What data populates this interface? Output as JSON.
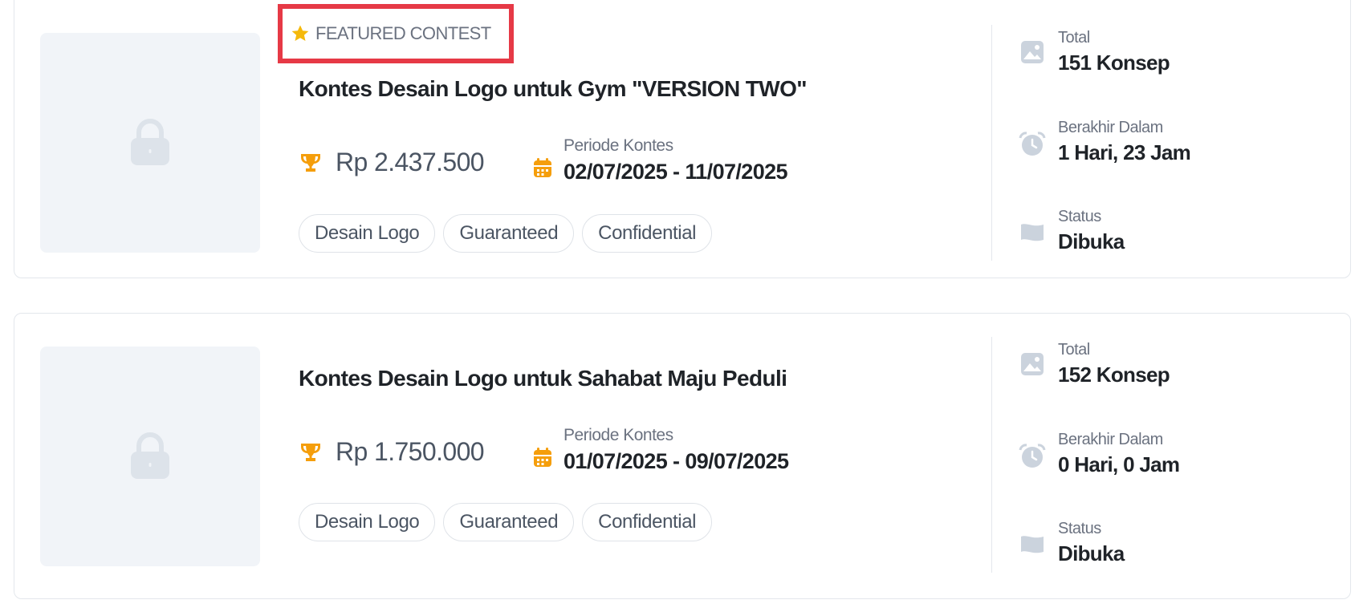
{
  "contests": [
    {
      "featured_label": "FEATURED CONTEST",
      "title": "Kontes Desain Logo untuk Gym \"VERSION TWO\"",
      "prize": "Rp 2.437.500",
      "period_label": "Periode Kontes",
      "period_value": "02/07/2025 - 11/07/2025",
      "tags": [
        "Desain Logo",
        "Guaranteed",
        "Confidential"
      ],
      "total_label": "Total",
      "total_value": "151 Konsep",
      "ends_label": "Berakhir Dalam",
      "ends_value": "1 Hari, 23 Jam",
      "status_label": "Status",
      "status_value": "Dibuka"
    },
    {
      "title": "Kontes Desain Logo untuk Sahabat Maju Peduli",
      "prize": "Rp 1.750.000",
      "period_label": "Periode Kontes",
      "period_value": "01/07/2025 - 09/07/2025",
      "tags": [
        "Desain Logo",
        "Guaranteed",
        "Confidential"
      ],
      "total_label": "Total",
      "total_value": "152 Konsep",
      "ends_label": "Berakhir Dalam",
      "ends_value": "0 Hari, 0 Jam",
      "status_label": "Status",
      "status_value": "Dibuka"
    }
  ],
  "icons": {
    "thumbnail": "lock-icon",
    "featured": "star-icon",
    "prize": "trophy-icon",
    "period": "calendar-icon",
    "total": "image-icon",
    "ends": "alarm-clock-icon",
    "status": "flag-icon"
  },
  "colors": {
    "highlight_border": "#e63946",
    "accent_orange": "#f59e0b",
    "star_yellow": "#f5b90b",
    "muted_icon": "#cbd3dd",
    "placeholder_bg": "#f1f4f8"
  }
}
